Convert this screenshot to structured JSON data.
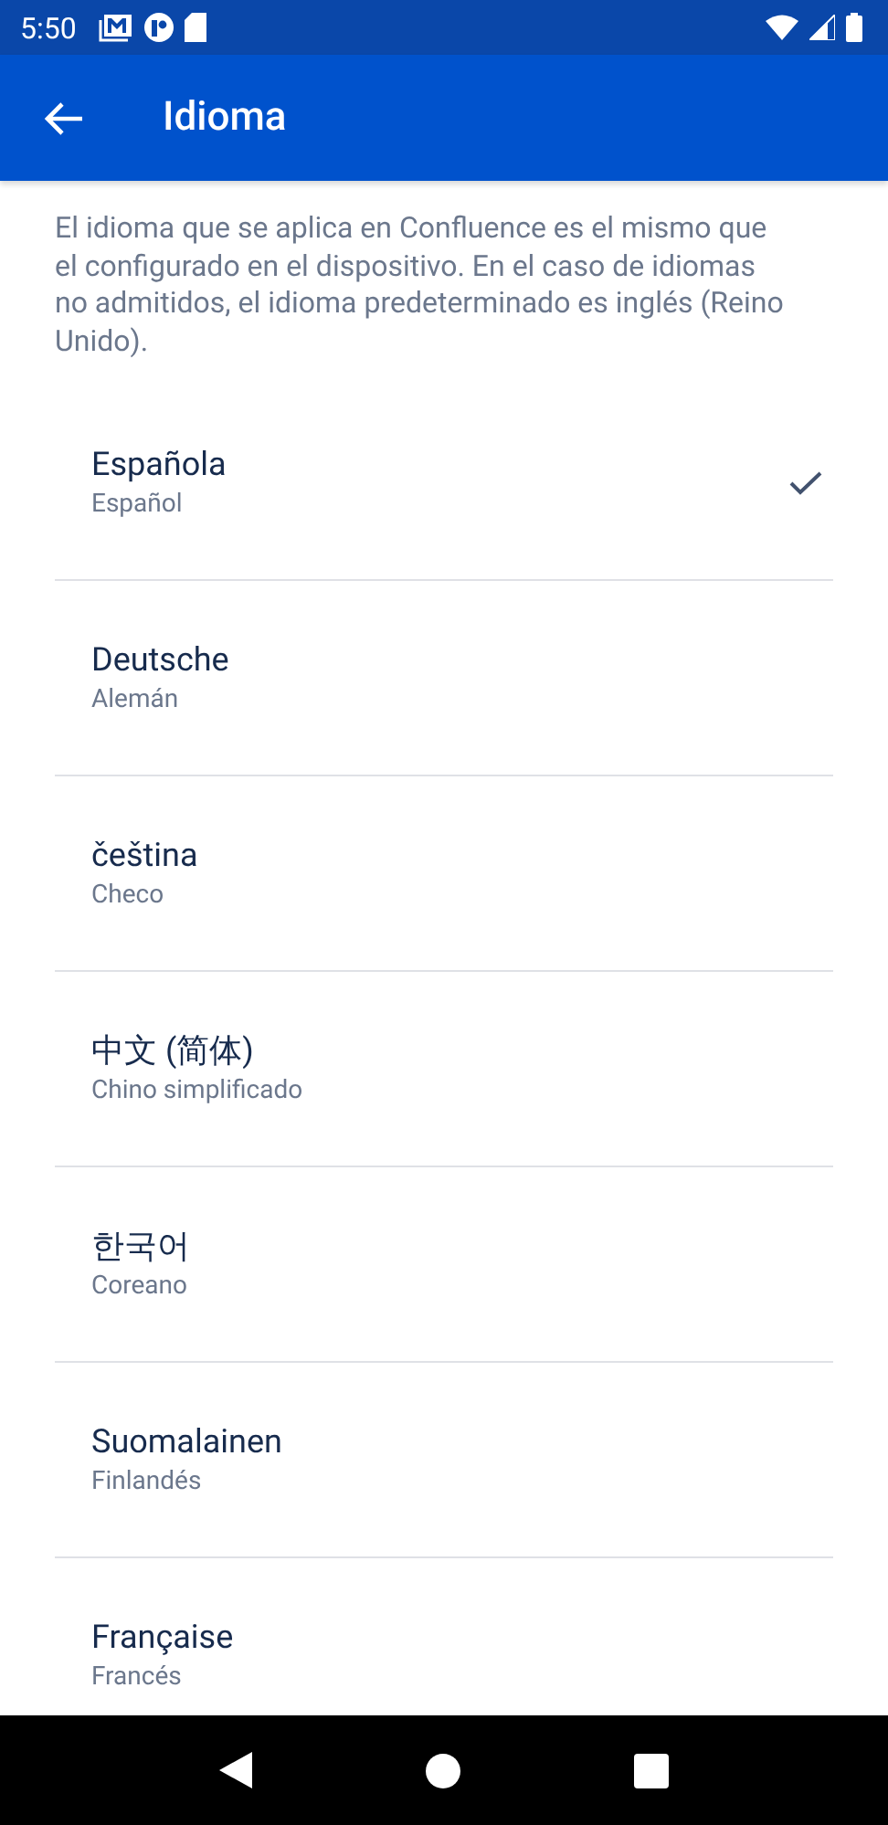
{
  "status_bar": {
    "time": "5:50"
  },
  "app_bar": {
    "title": "Idioma"
  },
  "description": "El idioma que se aplica en Confluence es el mismo que el configurado en el dispositivo. En el caso de idiomas no admitidos, el idioma predeterminado es inglés (Reino Unido).",
  "languages": [
    {
      "name": "Española",
      "subtitle": "Español",
      "selected": true
    },
    {
      "name": "Deutsche",
      "subtitle": "Alemán",
      "selected": false
    },
    {
      "name": "čeština",
      "subtitle": "Checo",
      "selected": false
    },
    {
      "name": "中文 (简体)",
      "subtitle": "Chino simplificado",
      "selected": false
    },
    {
      "name": "한국어",
      "subtitle": "Coreano",
      "selected": false
    },
    {
      "name": "Suomalainen",
      "subtitle": "Finlandés",
      "selected": false
    },
    {
      "name": "Française",
      "subtitle": "Francés",
      "selected": false
    }
  ]
}
